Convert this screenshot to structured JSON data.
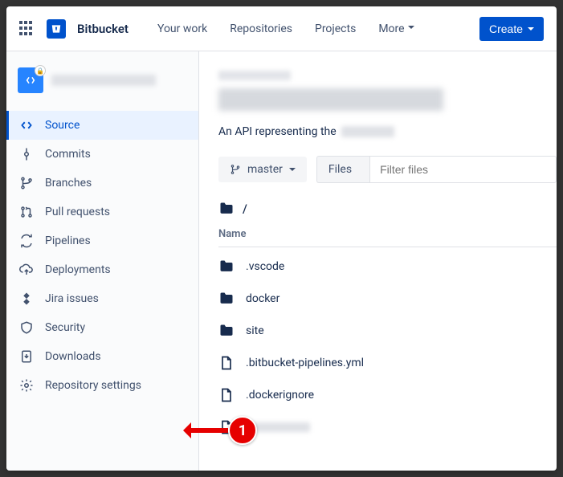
{
  "brand": "Bitbucket",
  "nav": {
    "your_work": "Your work",
    "repositories": "Repositories",
    "projects": "Projects",
    "more": "More",
    "create": "Create"
  },
  "sidebar": {
    "items": [
      {
        "label": "Source"
      },
      {
        "label": "Commits"
      },
      {
        "label": "Branches"
      },
      {
        "label": "Pull requests"
      },
      {
        "label": "Pipelines"
      },
      {
        "label": "Deployments"
      },
      {
        "label": "Jira issues"
      },
      {
        "label": "Security"
      },
      {
        "label": "Downloads"
      },
      {
        "label": "Repository settings"
      }
    ]
  },
  "main": {
    "desc_prefix": "An API representing the",
    "branch": "master",
    "files_label": "Files",
    "filter_placeholder": "Filter files",
    "path": "/",
    "col_name": "Name",
    "rows": [
      {
        "type": "folder",
        "name": ".vscode"
      },
      {
        "type": "folder",
        "name": "docker"
      },
      {
        "type": "folder",
        "name": "site"
      },
      {
        "type": "file",
        "name": ".bitbucket-pipelines.yml"
      },
      {
        "type": "file",
        "name": ".dockerignore"
      }
    ]
  },
  "annotation": {
    "num": "1"
  }
}
